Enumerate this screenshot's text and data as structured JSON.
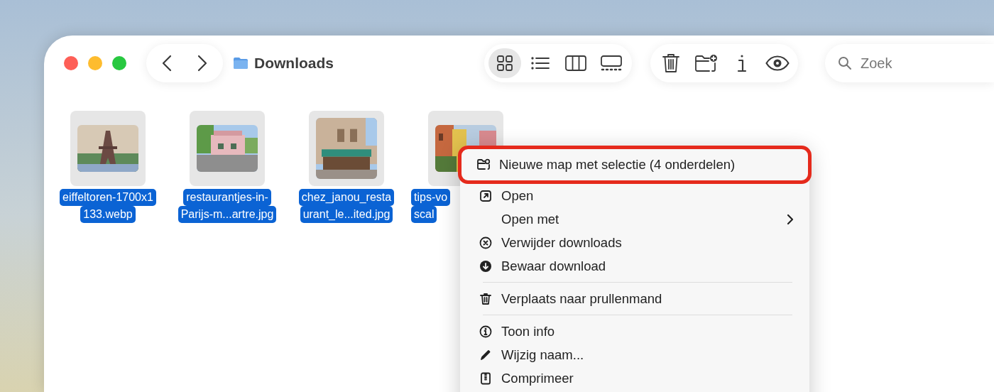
{
  "window": {
    "title": "Downloads"
  },
  "view_modes": [
    {
      "kind": "icons",
      "selected": true
    },
    {
      "kind": "list",
      "selected": false
    },
    {
      "kind": "columns",
      "selected": false
    },
    {
      "kind": "gallery",
      "selected": false
    }
  ],
  "actions": [
    {
      "kind": "trash"
    },
    {
      "kind": "new-folder"
    },
    {
      "kind": "info"
    },
    {
      "kind": "preview"
    }
  ],
  "search": {
    "placeholder": "Zoek"
  },
  "files": [
    {
      "lines": [
        "eiffeltoren-1700x1",
        "133.webp"
      ],
      "selected": true,
      "kind": "tower"
    },
    {
      "lines": [
        "restaurantjes-in-",
        "Parijs-m...artre.jpg"
      ],
      "selected": true,
      "kind": "house"
    },
    {
      "lines": [
        "chez_janou_resta",
        "urant_le...ited.jpg"
      ],
      "selected": true,
      "kind": "cafe"
    },
    {
      "lines": [
        "tips-vo",
        "scal"
      ],
      "selected": true,
      "kind": "street"
    }
  ],
  "context_menu": {
    "items": [
      {
        "kind": "item",
        "label": "Nieuwe map met selectie (4 onderdelen)",
        "submenu": false,
        "highlighted": true
      },
      {
        "kind": "item",
        "label": "Open",
        "submenu": false,
        "highlighted": false
      },
      {
        "kind": "item",
        "label": "Open met",
        "submenu": true,
        "highlighted": false
      },
      {
        "kind": "item",
        "label": "Verwijder downloads",
        "submenu": false,
        "highlighted": false
      },
      {
        "kind": "item",
        "label": "Bewaar download",
        "submenu": false,
        "highlighted": false
      },
      {
        "kind": "separator"
      },
      {
        "kind": "item",
        "label": "Verplaats naar prullenmand",
        "submenu": false,
        "highlighted": false
      },
      {
        "kind": "separator"
      },
      {
        "kind": "item",
        "label": "Toon info",
        "submenu": false,
        "highlighted": false
      },
      {
        "kind": "item",
        "label": "Wijzig naam...",
        "submenu": false,
        "highlighted": false
      },
      {
        "kind": "item",
        "label": "Comprimeer",
        "submenu": false,
        "highlighted": false
      }
    ]
  }
}
